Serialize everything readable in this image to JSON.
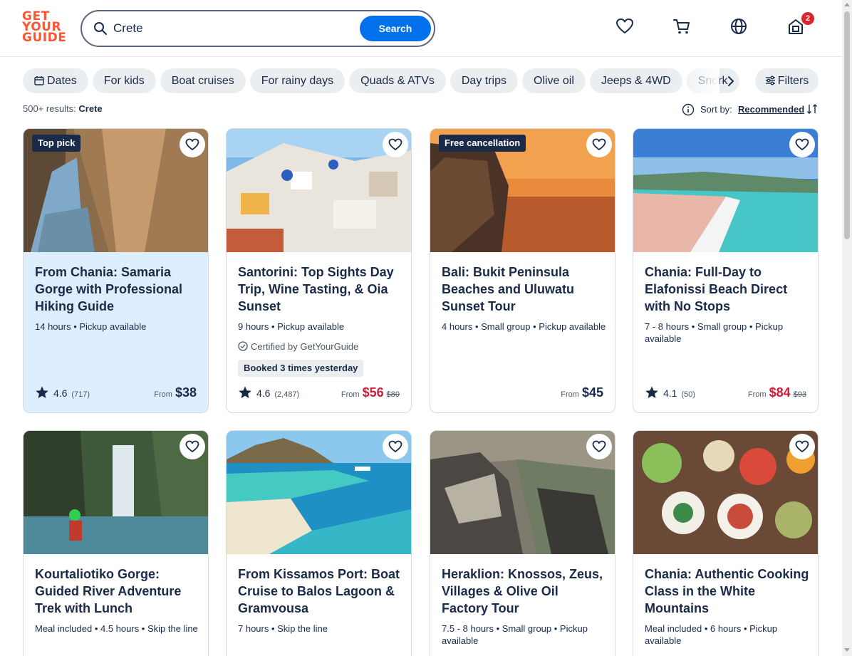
{
  "logo": [
    "GET",
    "YOUR",
    "GUIDE"
  ],
  "search": {
    "value": "Crete",
    "button": "Search"
  },
  "header": {
    "cart_badge": "2"
  },
  "chips": [
    "Dates",
    "For kids",
    "Boat cruises",
    "For rainy days",
    "Quads & ATVs",
    "Day trips",
    "Olive oil",
    "Jeeps & 4WD",
    "Snork"
  ],
  "filters_label": "Filters",
  "results": {
    "count": "500+ results:",
    "query": "Crete"
  },
  "sort": {
    "label": "Sort by:",
    "value": "Recommended"
  },
  "cards": [
    {
      "tag": "Top pick",
      "title": "From Chania: Samaria Gorge with Professional Hiking Guide",
      "meta": "14 hours • Pickup available",
      "rating": "4.6",
      "reviews": "(717)",
      "from": "From",
      "price": "$38"
    },
    {
      "title": "Santorini: Top Sights Day Trip, Wine Tasting, & Oia Sunset",
      "meta": "9 hours • Pickup available",
      "certified": "Certified by GetYourGuide",
      "booked": "Booked 3 times yesterday",
      "rating": "4.6",
      "reviews": "(2,487)",
      "from": "From",
      "price": "$56",
      "old_price": "$80"
    },
    {
      "tag": "Free cancellation",
      "title": "Bali: Bukit Peninsula Beaches and Uluwatu Sunset Tour",
      "meta": "4 hours • Small group • Pickup available",
      "from": "From",
      "price": "$45"
    },
    {
      "title": "Chania: Full-Day to Elafonissi Beach Direct with No Stops",
      "meta": "7 - 8 hours • Small group • Pickup available",
      "rating": "4.1",
      "reviews": "(50)",
      "from": "From",
      "price": "$84",
      "old_price": "$93"
    },
    {
      "title": "Kourtaliotiko Gorge: Guided River Adventure Trek with Lunch",
      "meta": "Meal included • 4.5 hours • Skip the line"
    },
    {
      "title": "From Kissamos Port: Boat Cruise to Balos Lagoon & Gramvousa",
      "meta": "7 hours • Skip the line"
    },
    {
      "title": "Heraklion: Knossos, Zeus, Villages & Olive Oil Factory Tour",
      "meta": "7.5 - 8 hours • Small group • Pickup available"
    },
    {
      "title": "Chania: Authentic Cooking Class in the White Mountains",
      "meta": "Meal included • 6 hours • Pickup available"
    }
  ],
  "colors": {
    "accent": "#0071eb",
    "brand": "#ff5533",
    "sale": "#d21c37",
    "navy": "#1a2b49",
    "highlight": "#ddeeff"
  }
}
